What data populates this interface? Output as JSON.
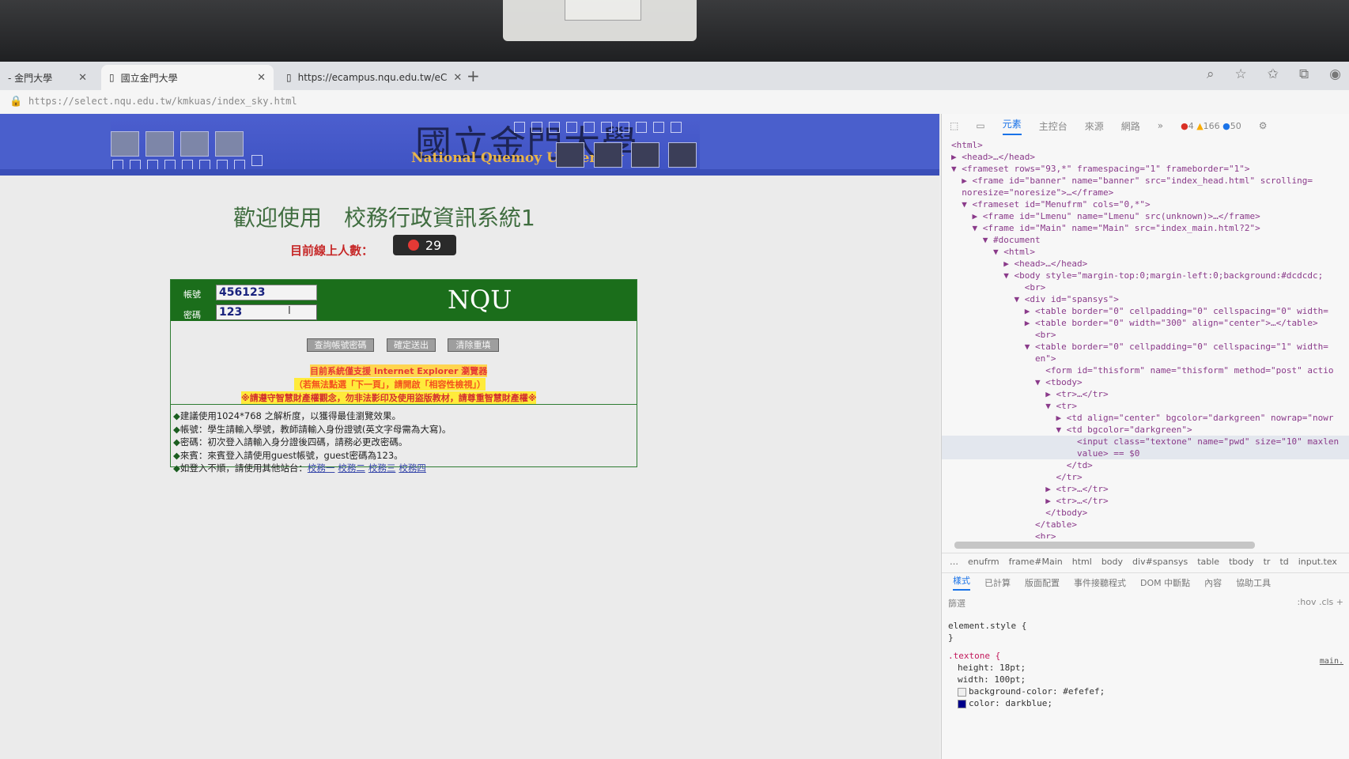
{
  "colors": {
    "banner": "#4a5fcc",
    "login_green": "#1b6e1b",
    "welcome_text": "#3f6d3f",
    "online_label": "#c62828",
    "devtools_accent": "#1a73e8"
  },
  "browser": {
    "tabs": [
      {
        "label": "- 金門大學"
      },
      {
        "label": "國立金門大學",
        "icon": "page-icon"
      },
      {
        "label": "https://ecampus.nqu.edu.tw/eC",
        "icon": "page-icon"
      }
    ],
    "new_tab": "+",
    "address": "https://select.nqu.edu.tw/kmkuas/index_sky.html"
  },
  "page": {
    "logo_cn": "國立金門大學",
    "logo_en": "National Quemoy University",
    "welcome": "歡迎使用　校務行政資訊系統1",
    "online_label": "目前線上人數：",
    "online_count": "29",
    "login": {
      "account_label": "帳號",
      "account_value": "456123",
      "password_label": "密碼",
      "password_value": "123",
      "brand": "NQU",
      "buttons": [
        "查詢帳號密碼",
        "確定送出",
        "清除重填"
      ],
      "warnings": [
        "目前系統僅支援 Internet Explorer 瀏覽器",
        "（若無法點選「下一頁」，請開啟「相容性檢視」）",
        "※請遵守智慧財產權觀念，勿非法影印及使用盜版教材，請尊重智慧財產權※"
      ],
      "notes": [
        "建議使用1024*768 之解析度，以獲得最佳瀏覽效果。",
        "帳號：學生請輸入學號，教師請輸入身份證號(英文字母需為大寫)。",
        "密碼：初次登入請輸入身分證後四碼，請務必更改密碼。",
        "來賓：來賓登入請使用guest帳號，guest密碼為123。",
        "如登入不順，請使用其他站台："
      ],
      "alt_sites": [
        "校務一",
        "校務二",
        "校務三",
        "校務四"
      ]
    }
  },
  "devtools": {
    "tabs": [
      "元素",
      "主控台",
      "來源",
      "網路"
    ],
    "more": "»",
    "errors": "4",
    "warnings": "166",
    "info": "50",
    "dom_lines": [
      "<html>",
      "▶ <head>…</head>",
      "▼ <frameset rows=\"93,*\" framespacing=\"1\" frameborder=\"1\">",
      "  ▶ <frame id=\"banner\" name=\"banner\" src=\"index_head.html\" scrolling=",
      "  noresize=\"noresize\">…</frame>",
      "  ▼ <frameset id=\"Menufrm\" cols=\"0,*\">",
      "    ▶ <frame id=\"Lmenu\" name=\"Lmenu\" src(unknown)>…</frame>",
      "    ▼ <frame id=\"Main\" name=\"Main\" src=\"index_main.html?2\">",
      "      ▼ #document",
      "        ▼ <html>",
      "          ▶ <head>…</head>",
      "          ▼ <body style=\"margin-top:0;margin-left:0;background:#dcdcdc;",
      "              <br>",
      "            ▼ <div id=\"spansys\">",
      "              ▶ <table border=\"0\" cellpadding=\"0\" cellspacing=\"0\" width=",
      "              ▶ <table border=\"0\" width=\"300\" align=\"center\">…</table>",
      "                <br>",
      "              ▼ <table border=\"0\" cellpadding=\"0\" cellspacing=\"1\" width=",
      "                en\">",
      "                  <form id=\"thisform\" name=\"thisform\" method=\"post\" actio",
      "                ▼ <tbody>",
      "                  ▶ <tr>…</tr>",
      "                  ▼ <tr>",
      "                    ▶ <td align=\"center\" bgcolor=\"darkgreen\" nowrap=\"nowr",
      "                    ▼ <td bgcolor=\"darkgreen\">",
      "                        <input class=\"textone\" name=\"pwd\" size=\"10\" maxlen",
      "                        value> == $0",
      "                      </td>",
      "                    </tr>",
      "                  ▶ <tr>…</tr>",
      "                  ▶ <tr>…</tr>",
      "                  </tbody>",
      "                </table>",
      "                <br>",
      "                <!--"
    ],
    "breadcrumbs": [
      "…",
      "enufrm",
      "frame#Main",
      "html",
      "body",
      "div#spansys",
      "table",
      "tbody",
      "tr",
      "td",
      "input.tex"
    ],
    "style_tabs": [
      "樣式",
      "已計算",
      "版面配置",
      "事件接聽程式",
      "DOM 中斷點",
      "內容",
      "協助工具"
    ],
    "filter_placeholder": "篩選",
    "filter_right": ":hov  .cls  +",
    "styles": {
      "element_style": "element.style {",
      "close": "}",
      "rule": ".textone {",
      "props": [
        "height: 18pt;",
        "width: 100pt;",
        "background-color: #efefef;",
        "color: darkblue;"
      ],
      "source": "main."
    }
  }
}
